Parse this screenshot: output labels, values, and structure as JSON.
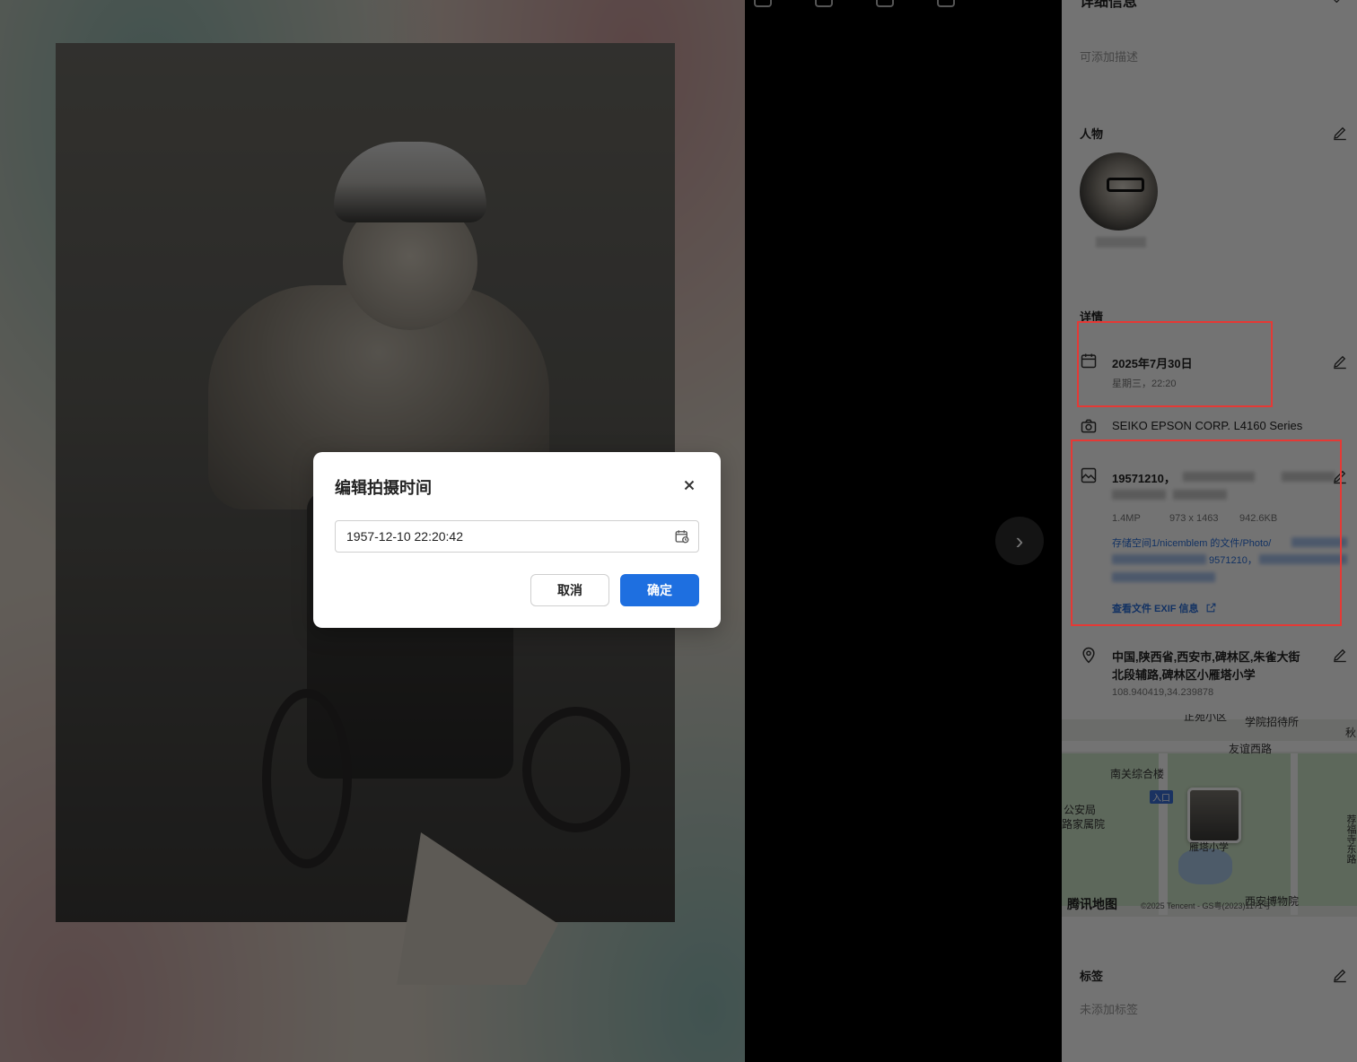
{
  "panel": {
    "title": "详细信息",
    "description_placeholder": "可添加描述",
    "people_heading": "人物",
    "details_heading": "详情",
    "tags_heading": "标签",
    "tags_placeholder": "未添加标签",
    "date_main": "2025年7月30日",
    "date_sub": "星期三，22:20",
    "camera": "SEIKO EPSON CORP. L4160 Series",
    "file_name_prefix": "19571210，",
    "file_megapixels": "1.4MP",
    "file_resolution": "973 x 1463",
    "file_size": "942.6KB",
    "file_path_prefix": "存储空间1/nicemblem 的文件/Photo/",
    "file_path_line2": "9571210，",
    "exif_link": "查看文件 EXIF 信息",
    "location_line1": "中国,陕西省,西安市,碑林区,朱雀大街",
    "location_line2": "北段辅路,碑林区小雁塔小学",
    "coordinates": "108.940419,34.239878"
  },
  "map": {
    "labels": [
      "正苑小区",
      "学院招待所",
      "秋",
      "友谊西路",
      "南关综合楼",
      "入口",
      "公安局",
      "路家属院",
      "雁塔小学",
      "西安博物院",
      "荐福寺东路"
    ],
    "provider": "腾讯地图",
    "copyright": "©2025 Tencent - GS粤(2023)1171号"
  },
  "dialog": {
    "title": "编辑拍摄时间",
    "datetime_value": "1957-12-10 22:20:42",
    "cancel_label": "取消",
    "confirm_label": "确定"
  },
  "colors": {
    "primary": "#1e6fe0",
    "link": "#2a6fdb",
    "annotation": "#e53935"
  }
}
